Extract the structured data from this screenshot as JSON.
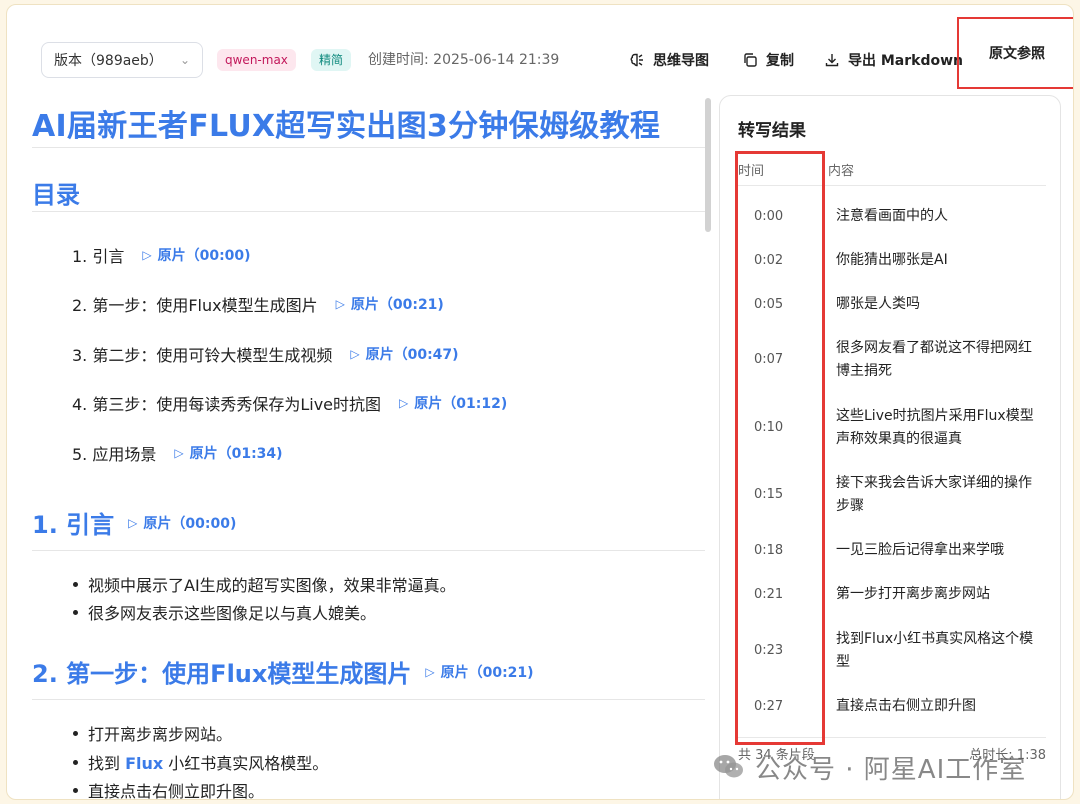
{
  "toolbar": {
    "version_label": "版本（989aeb）",
    "model_tag": "qwen-max",
    "mode_tag": "精简",
    "created_time": "创建时间: 2025-06-14 21:39",
    "mindmap_label": "思维导图",
    "copy_label": "复制",
    "export_label": "导出 Markdown",
    "source_label": "原文参照"
  },
  "article": {
    "title": "AI届新王者FLUX超写实出图3分钟保姆级教程",
    "toc_heading": "目录",
    "toc": [
      {
        "label": "1. 引言",
        "link": "原片（00:00)"
      },
      {
        "label": "2. 第一步：使用Flux模型生成图片",
        "link": "原片（00:21)"
      },
      {
        "label": "3. 第二步：使用可铃大模型生成视频",
        "link": "原片（00:47)"
      },
      {
        "label": "4. 第三步：使用每读秀秀保存为Live时抗图",
        "link": "原片（01:12)"
      },
      {
        "label": "5. 应用场景",
        "link": "原片（01:34)"
      }
    ],
    "section1": {
      "heading": "1. 引言",
      "link": "原片（00:00)",
      "bullets": [
        "视频中展示了AI生成的超写实图像，效果非常逼真。",
        "很多网友表示这些图像足以与真人媲美。"
      ]
    },
    "section2": {
      "heading": "2. 第一步：使用Flux模型生成图片",
      "link": "原片（00:21)",
      "bullet1": "打开离步离步网站。",
      "bullet2_prefix": "找到 ",
      "bullet2_link": "Flux",
      "bullet2_suffix": " 小红书真实风格模型。",
      "bullet3": "直接点击右侧立即升图。"
    }
  },
  "transcript": {
    "title": "转写结果",
    "col_time": "时间",
    "col_content": "内容",
    "rows": [
      {
        "time": "0:00",
        "text": "注意看画面中的人"
      },
      {
        "time": "0:02",
        "text": "你能猜出哪张是AI"
      },
      {
        "time": "0:05",
        "text": "哪张是人类吗"
      },
      {
        "time": "0:07",
        "text": "很多网友看了都说这不得把网红博主捐死"
      },
      {
        "time": "0:10",
        "text": "这些Live时抗图片采用Flux模型声称效果真的很逼真"
      },
      {
        "time": "0:15",
        "text": "接下来我会告诉大家详细的操作步骤"
      },
      {
        "time": "0:18",
        "text": "一见三脸后记得拿出来学哦"
      },
      {
        "time": "0:21",
        "text": "第一步打开离步离步网站"
      },
      {
        "time": "0:23",
        "text": "找到Flux小红书真实风格这个模型"
      },
      {
        "time": "0:27",
        "text": "直接点击右侧立即升图"
      }
    ],
    "footer_count": "共 34 条片段",
    "footer_duration": "总时长: 1:38"
  },
  "watermark": "公众号 · 阿星AI工作室",
  "colors": {
    "accent": "#3b7be8",
    "highlight": "#e53935"
  }
}
